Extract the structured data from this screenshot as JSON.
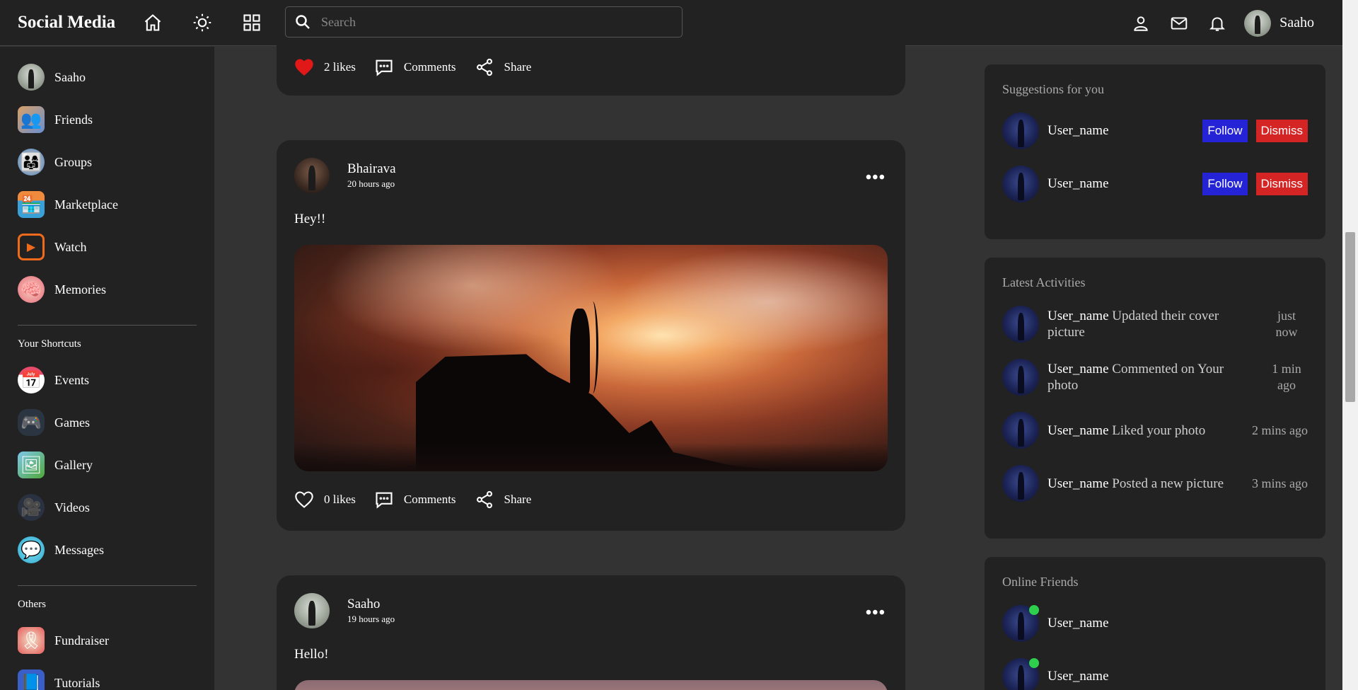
{
  "navbar": {
    "logo": "Social Media",
    "search_placeholder": "Search",
    "username": "Saaho"
  },
  "leftbar": {
    "user": "Saaho",
    "items": [
      {
        "label": "Friends",
        "icon": "friends-icon"
      },
      {
        "label": "Groups",
        "icon": "groups-icon"
      },
      {
        "label": "Marketplace",
        "icon": "marketplace-icon"
      },
      {
        "label": "Watch",
        "icon": "watch-icon"
      },
      {
        "label": "Memories",
        "icon": "memories-icon"
      }
    ],
    "shortcuts_title": "Your Shortcuts",
    "shortcuts": [
      {
        "label": "Events",
        "icon": "events-icon"
      },
      {
        "label": "Games",
        "icon": "games-icon"
      },
      {
        "label": "Gallery",
        "icon": "gallery-icon"
      },
      {
        "label": "Videos",
        "icon": "videos-icon"
      },
      {
        "label": "Messages",
        "icon": "messages-icon"
      }
    ],
    "others_title": "Others",
    "others": [
      {
        "label": "Fundraiser",
        "icon": "fundraiser-icon"
      },
      {
        "label": "Tutorials",
        "icon": "tutorials-icon"
      }
    ]
  },
  "feed": {
    "post0": {
      "likes": "2 likes",
      "comments": "Comments",
      "share": "Share"
    },
    "post1": {
      "name": "Bhairava",
      "time": "20 hours ago",
      "text": "Hey!!",
      "likes": "0 likes",
      "comments": "Comments",
      "share": "Share"
    },
    "post2": {
      "name": "Saaho",
      "time": "19 hours ago",
      "text": "Hello!"
    }
  },
  "suggestions": {
    "title": "Suggestions for you",
    "users": [
      {
        "name": "User_name",
        "follow": "Follow",
        "dismiss": "Dismiss"
      },
      {
        "name": "User_name",
        "follow": "Follow",
        "dismiss": "Dismiss"
      }
    ]
  },
  "activities": {
    "title": "Latest Activities",
    "items": [
      {
        "user": "User_name",
        "text": "Updated their cover picture",
        "time": "just now"
      },
      {
        "user": "User_name",
        "text": "Commented on Your photo",
        "time": "1 min ago"
      },
      {
        "user": "User_name",
        "text": "Liked your photo",
        "time": "2 mins ago"
      },
      {
        "user": "User_name",
        "text": "Posted a new picture",
        "time": "3 mins ago"
      }
    ]
  },
  "online": {
    "title": "Online Friends",
    "users": [
      {
        "name": "User_name"
      },
      {
        "name": "User_name"
      }
    ]
  },
  "colors": {
    "like_red": "#e01818",
    "follow_blue": "#2424d6",
    "dismiss_red": "#d42424",
    "online_green": "#2fcf4e"
  }
}
